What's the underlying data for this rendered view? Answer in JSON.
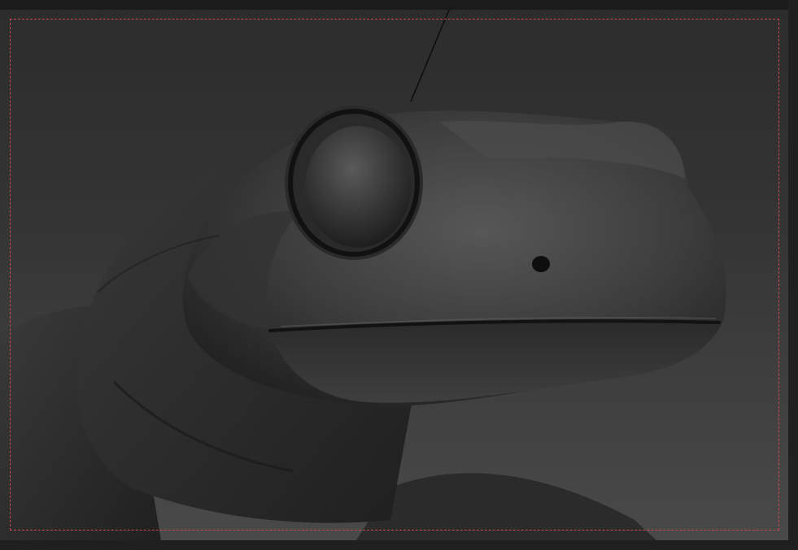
{
  "viewport": {
    "background_top": "#2c2c2c",
    "background_bottom": "#4a4a4a",
    "safe_frame_color": "#c94a55",
    "model_base_color": "#3b3b3b",
    "model_highlight_color": "#575757",
    "model_shadow_color": "#151515"
  },
  "icons": {
    "frame": "dashed-frame-guide",
    "model": "frog-sculpt"
  }
}
